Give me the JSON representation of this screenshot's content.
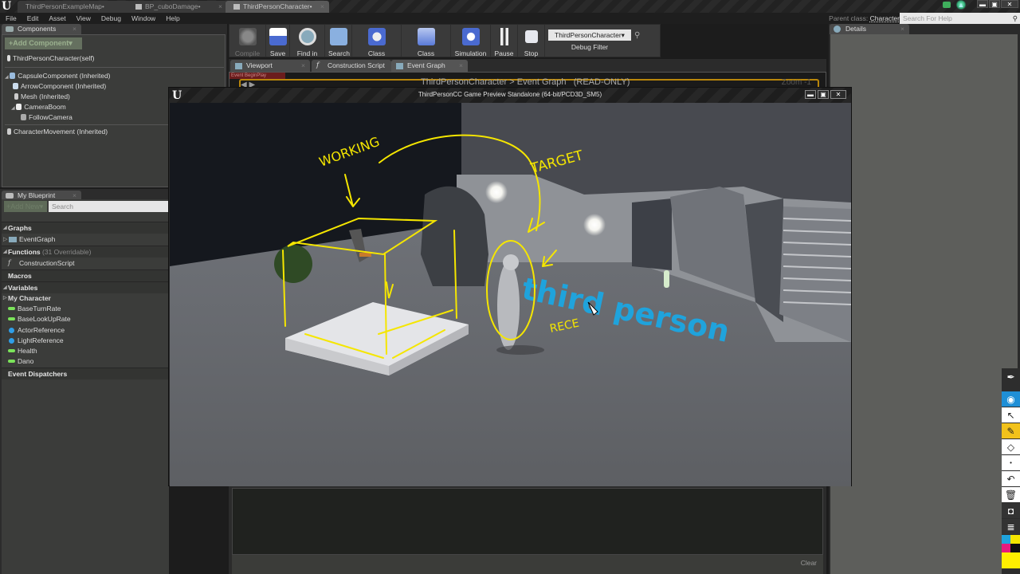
{
  "window": {
    "doc_tabs": [
      {
        "label": "ThirdPersonExampleMap•",
        "active": false
      },
      {
        "label": "BP_cuboDamage•",
        "active": false
      },
      {
        "label": "ThirdPersonCharacter•",
        "active": true
      }
    ],
    "controls": {
      "minimize": "▬",
      "maximize": "▣",
      "close": "✕"
    }
  },
  "menu": [
    "File",
    "Edit",
    "Asset",
    "View",
    "Debug",
    "Window",
    "Help"
  ],
  "header": {
    "parent_class_label": "Parent class:",
    "parent_class_value": "Character",
    "help_search_placeholder": "Search For Help"
  },
  "components_panel": {
    "title": "Components",
    "add_button": "+Add Component▾",
    "root": "ThirdPersonCharacter(self)",
    "tree": [
      {
        "label": "CapsuleComponent (Inherited)",
        "depth": 0,
        "expander": true
      },
      {
        "label": "ArrowComponent (Inherited)",
        "depth": 1
      },
      {
        "label": "Mesh (Inherited)",
        "depth": 1
      },
      {
        "label": "CameraBoom",
        "depth": 1,
        "expander": true
      },
      {
        "label": "FollowCamera",
        "depth": 2
      }
    ],
    "movement": "CharacterMovement (Inherited)"
  },
  "my_blueprint": {
    "title": "My Blueprint",
    "add_new": "+Add New▾",
    "search_placeholder": "Search",
    "sections": {
      "graphs": "Graphs",
      "graph_items": [
        "EventGraph"
      ],
      "functions": "Functions",
      "functions_sub": "(31 Overridable)",
      "function_items": [
        "ConstructionScript"
      ],
      "macros": "Macros",
      "variables": "Variables",
      "category": "My Character",
      "event_dispatchers": "Event Dispatchers"
    },
    "variables": [
      {
        "name": "BaseTurnRate",
        "type": "float",
        "color": "#7be35a"
      },
      {
        "name": "BaseLookUpRate",
        "type": "float",
        "color": "#7be35a"
      },
      {
        "name": "ActorReference",
        "type": "object",
        "color": "#2f9ee8"
      },
      {
        "name": "LightReference",
        "type": "object",
        "color": "#2f9ee8"
      },
      {
        "name": "Health",
        "type": "float",
        "color": "#7be35a"
      },
      {
        "name": "Dano",
        "type": "float",
        "color": "#7be35a"
      }
    ]
  },
  "toolbar": {
    "buttons": [
      {
        "label": "Compile",
        "icon": "compile-icon"
      },
      {
        "label": "Save",
        "icon": "save-icon"
      },
      {
        "label": "Find in CB",
        "icon": "find-icon"
      },
      {
        "label": "Search",
        "icon": "binoculars-icon"
      },
      {
        "label": "Class Settings",
        "icon": "class-settings-icon"
      },
      {
        "label": "Class Defaults",
        "icon": "class-defaults-icon"
      },
      {
        "label": "Simulation",
        "icon": "simulation-icon"
      },
      {
        "label": "Pause",
        "icon": "pause-icon"
      },
      {
        "label": "Stop",
        "icon": "stop-icon"
      }
    ],
    "debug_filter": {
      "selected": "ThirdPersonCharacter▾",
      "label": "Debug Filter"
    }
  },
  "editor_tabs": [
    {
      "label": "Viewport"
    },
    {
      "label": "Construction Script"
    },
    {
      "label": "Event Graph",
      "active": true
    }
  ],
  "graph": {
    "breadcrumb_class": "ThirdPersonCharacter",
    "breadcrumb_sep": ">",
    "breadcrumb_graph": "Event Graph",
    "readonly": "(READ-ONLY)",
    "zoom": "Zoom -1",
    "node": "Event BeginPlay"
  },
  "details": {
    "title": "Details"
  },
  "output_log": {
    "clear": "Clear"
  },
  "game_preview": {
    "title": "ThirdPersonCC Game Preview Standalone (64-bit/PCD3D_SM5)",
    "floor_text": "third person",
    "annotations": [
      "WORKING",
      "TARGET",
      "RECE"
    ]
  },
  "annotation_tools": [
    "pen-icon",
    "eye-icon",
    "pointer-icon",
    "highlighter-icon",
    "eraser-icon",
    "dot-size-icon",
    "undo-icon",
    "trash-icon",
    "camera-icon",
    "notes-icon"
  ],
  "palette": [
    "#1fa3dc",
    "#f5e600",
    "#e6197d",
    "#111111",
    "#ffef00"
  ]
}
